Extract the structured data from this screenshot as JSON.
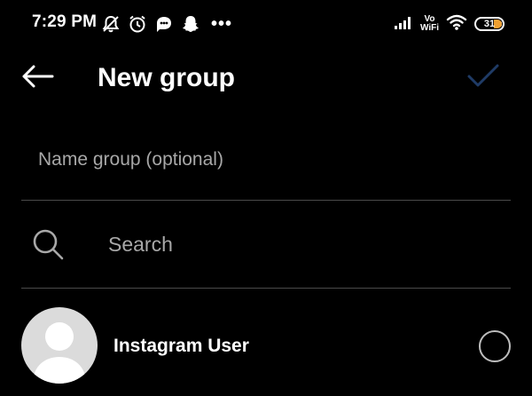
{
  "status_bar": {
    "time": "7:29 PM",
    "left_icons": [
      "muted-bell-icon",
      "alarm-clock-icon",
      "chat-bubble-icon",
      "snapchat-ghost-icon"
    ],
    "more": "•••",
    "right_icons": [
      "cellular-signal-icon",
      "vowifi-icon",
      "wifi-icon",
      "battery-icon"
    ],
    "vowifi_top": "Vo",
    "vowifi_bottom": "WiFi",
    "battery_level": "31",
    "battery_color": "#f0a030"
  },
  "header": {
    "back_icon": "arrow-left-icon",
    "title": "New group",
    "confirm_icon": "checkmark-icon",
    "confirm_color": "#1f3b66"
  },
  "name_group": {
    "placeholder": "Name group (optional)",
    "value": ""
  },
  "search": {
    "icon": "search-icon",
    "placeholder": "Search",
    "value": ""
  },
  "contacts": [
    {
      "name": "Instagram User",
      "avatar_icon": "default-avatar-icon",
      "selected": false
    }
  ]
}
